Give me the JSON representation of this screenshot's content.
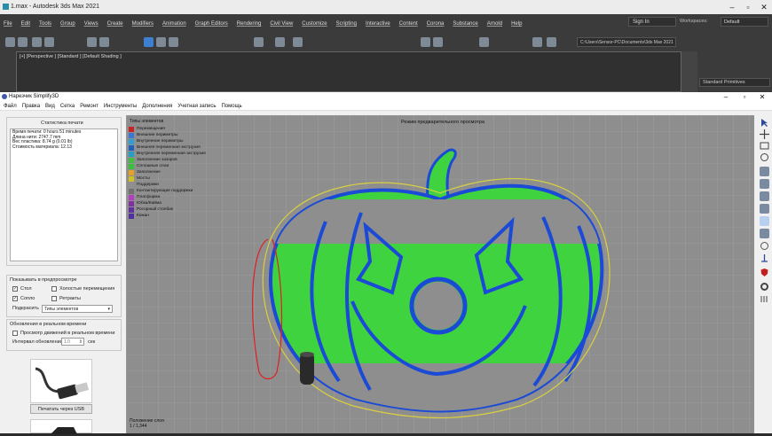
{
  "max": {
    "title": "1.max - Autodesk 3ds Max 2021",
    "menu": [
      "File",
      "Edit",
      "Tools",
      "Group",
      "Views",
      "Create",
      "Modifiers",
      "Animation",
      "Graph Editors",
      "Rendering",
      "Civil View",
      "Customize",
      "Scripting",
      "Interactive",
      "Content",
      "Corona",
      "Substance",
      "Arnold",
      "Help"
    ],
    "sign_in": "Sign In",
    "workspaces_label": "Workspaces:",
    "workspaces_value": "Default",
    "project_path": "C:\\Users\\Sensor-PC\\Documents\\3ds Max 2021",
    "viewport_label": "[+] [Perspective ] [Standard ] [Default Shading ]",
    "standard_primitives": "Standard Primitives"
  },
  "s3d": {
    "title": "Нарезчик Simplify3D",
    "menu": [
      "Файл",
      "Правка",
      "Вид",
      "Сетка",
      "Ремонт",
      "Инструменты",
      "Дополнения",
      "Учетная запись",
      "Помощь"
    ],
    "stats_title": "Статистика печати",
    "stats": [
      "Время печати: 0 hours 51 minutes",
      "Длина нити: 2747.7 mm",
      "Вес пластика: 8.74 g (0.01 lb)",
      "Стоимость материала: 12.13"
    ],
    "show_in_preview": "Показывать в предпросмотре",
    "checkboxes": [
      {
        "label": "Стол",
        "checked": true
      },
      {
        "label": "Холостые перемещения",
        "checked": false
      },
      {
        "label": "Сопло",
        "checked": true
      },
      {
        "label": "Ретракты",
        "checked": false
      }
    ],
    "color_by_label": "Подкрасить",
    "color_by_value": "Типы элементов",
    "realtime_title": "Обновления в реальном времени",
    "realtime_check": "Просмотр движений в реальном времени",
    "interval_label": "Интервал обновления",
    "interval_value": "1.0",
    "interval_unit": "сек",
    "usb_button": "Печатать через USB",
    "preview_title": "Режим предварительного просмотра",
    "legend_title": "Типы элементов",
    "legend": [
      {
        "name": "Перемещения",
        "color": "#cc2222"
      },
      {
        "name": "Внешние периметры",
        "color": "#3a78d8"
      },
      {
        "name": "Внутренние периметры",
        "color": "#2f9fd0"
      },
      {
        "name": "Внешняя переменная экструзия",
        "color": "#2060c0"
      },
      {
        "name": "Внутренняя переменная экструзия",
        "color": "#20a0c8"
      },
      {
        "name": "Заполнение зазоров",
        "color": "#40c040"
      },
      {
        "name": "Сплошные слои",
        "color": "#36c236"
      },
      {
        "name": "Заполнение",
        "color": "#e8a020"
      },
      {
        "name": "Мосты",
        "color": "#d0c020"
      },
      {
        "name": "Поддержки",
        "color": "#909090"
      },
      {
        "name": "Контактирующие поддержки",
        "color": "#707070"
      },
      {
        "name": "Платформа",
        "color": "#b040c0"
      },
      {
        "name": "Юбка/Кайма",
        "color": "#8030a0"
      },
      {
        "name": "Росорный столбик",
        "color": "#6030a0"
      },
      {
        "name": "Кожан",
        "color": "#5030a0"
      }
    ],
    "layer_label": "Положение слоя",
    "layer_value": "1 / 1,344"
  }
}
